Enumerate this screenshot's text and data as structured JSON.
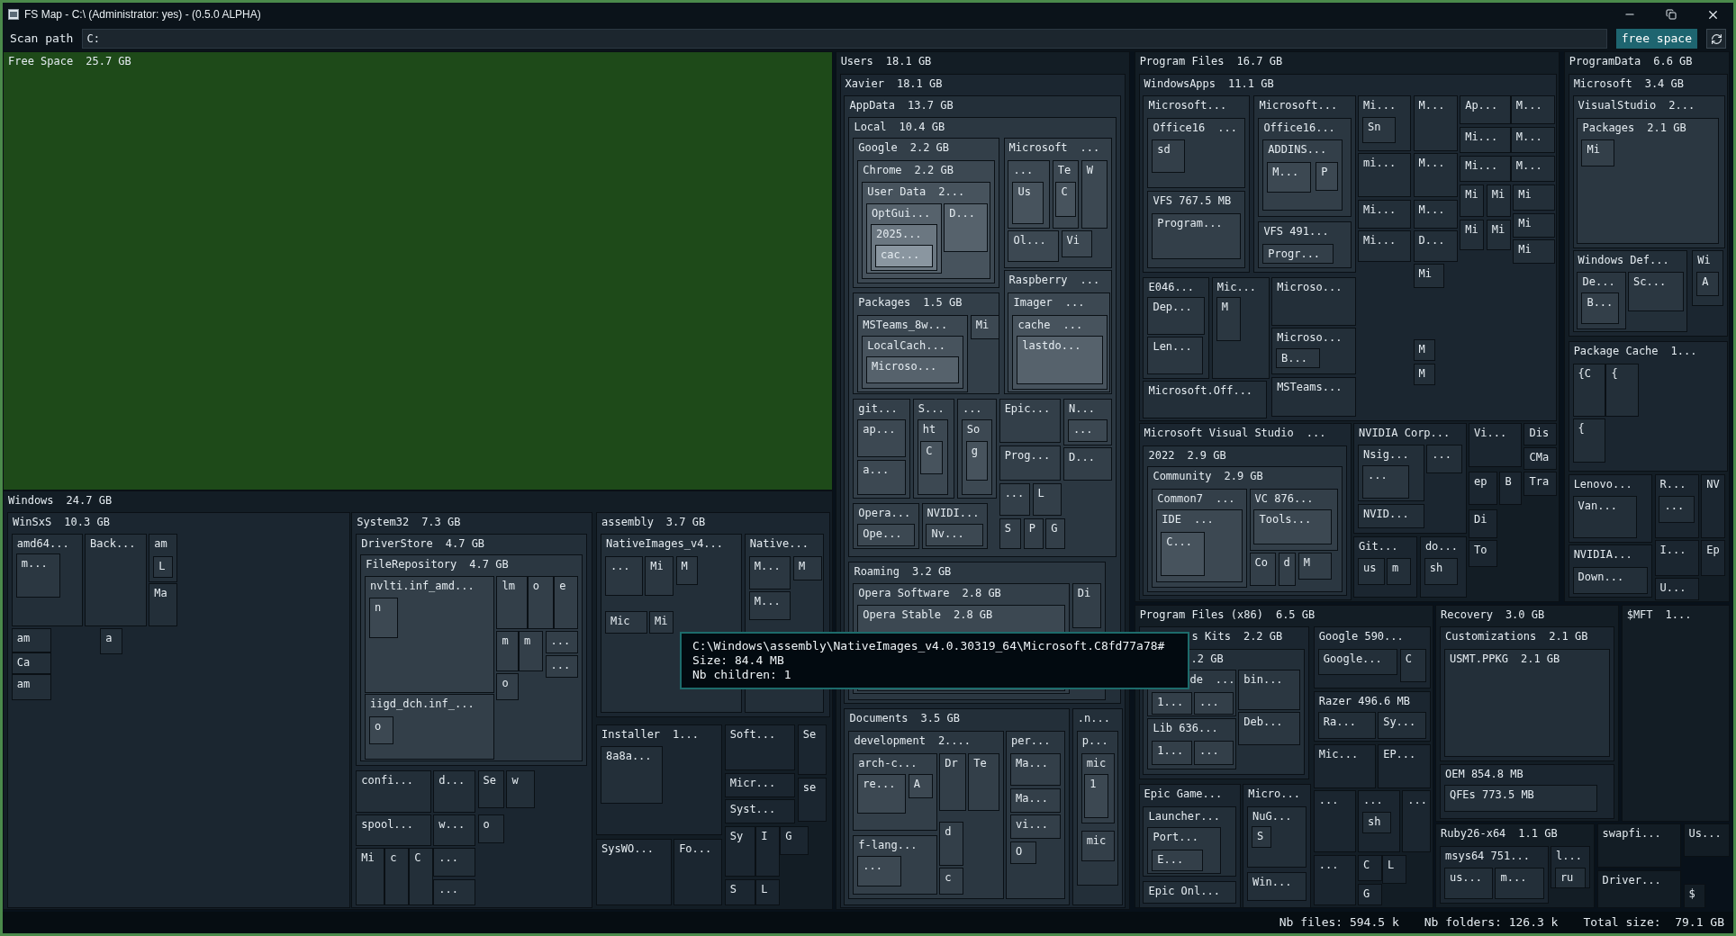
{
  "window": {
    "title": "FS Map - C:\\ (Administrator: yes) - (0.5.0 ALPHA)"
  },
  "toolbar": {
    "scan_label": "Scan path",
    "scan_path": "C:",
    "free_space_button": "free space"
  },
  "treemap": [
    {
      "kind": "free",
      "label": "Free Space",
      "size": "25.7 GB"
    },
    {
      "kind": "folder",
      "label": "Windows",
      "size": "24.7 GB",
      "children": [
        {
          "label": "WinSxS",
          "size": "10.3 GB",
          "children": [
            {
              "label": "amd64...",
              "children": [
                {
                  "label": "m..."
                }
              ]
            },
            {
              "label": "Back..."
            },
            {
              "label": "am",
              "children": [
                {
                  "label": "L"
                }
              ]
            },
            {
              "label": "Ma"
            },
            {
              "label": "am"
            },
            {
              "label": "Ca"
            },
            {
              "label": "am"
            },
            {
              "label": "a"
            }
          ]
        },
        {
          "label": "System32",
          "size": "7.3 GB",
          "children": [
            {
              "label": "DriverStore",
              "size": "4.7 GB",
              "children": [
                {
                  "label": "FileRepository",
                  "size": "4.7 GB",
                  "children": [
                    {
                      "label": "nvlti.inf_amd...",
                      "children": [
                        {
                          "label": "n"
                        }
                      ]
                    },
                    {
                      "label": "iigd_dch.inf_...",
                      "children": [
                        {
                          "label": "o"
                        }
                      ]
                    },
                    {
                      "label": "lm"
                    },
                    {
                      "label": "o"
                    },
                    {
                      "label": "e"
                    },
                    {
                      "label": "m"
                    },
                    {
                      "label": "m"
                    },
                    {
                      "label": "..."
                    },
                    {
                      "label": "..."
                    },
                    {
                      "label": "o"
                    }
                  ]
                }
              ]
            },
            {
              "label": "confi..."
            },
            {
              "label": "d..."
            },
            {
              "label": "Se"
            },
            {
              "label": "w"
            },
            {
              "label": "spool..."
            },
            {
              "label": "w..."
            },
            {
              "label": "o"
            },
            {
              "label": "Mi"
            },
            {
              "label": "c"
            },
            {
              "label": "C"
            },
            {
              "label": "..."
            },
            {
              "label": "..."
            }
          ]
        },
        {
          "label": "assembly",
          "size": "3.7 GB",
          "children": [
            {
              "label": "NativeImages_v4...",
              "children": [
                {
                  "label": "..."
                },
                {
                  "label": "Mi"
                },
                {
                  "label": "M"
                },
                {
                  "label": "Mic"
                },
                {
                  "label": "Mi"
                }
              ]
            },
            {
              "label": "Native...",
              "children": [
                {
                  "label": "M..."
                },
                {
                  "label": "M"
                },
                {
                  "label": "M..."
                }
              ]
            }
          ]
        },
        {
          "label": "Installer",
          "size": "1...",
          "children": [
            {
              "label": "8a8a..."
            }
          ]
        },
        {
          "label": "Soft..."
        },
        {
          "label": "Se"
        },
        {
          "label": "Micr..."
        },
        {
          "label": "se"
        },
        {
          "label": "Syst..."
        },
        {
          "label": "SysWO..."
        },
        {
          "label": "Fo..."
        },
        {
          "label": "Sy"
        },
        {
          "label": "I"
        },
        {
          "label": "G"
        },
        {
          "label": "S"
        },
        {
          "label": "L"
        }
      ]
    },
    {
      "kind": "folder",
      "label": "Users",
      "size": "18.1 GB",
      "children": [
        {
          "label": "Xavier",
          "size": "18.1 GB",
          "children": [
            {
              "label": "AppData",
              "size": "13.7 GB",
              "children": [
                {
                  "label": "Local",
                  "size": "10.4 GB",
                  "children": [
                    {
                      "label": "Google",
                      "size": "2.2 GB",
                      "children": [
                        {
                          "label": "Chrome",
                          "size": "2.2 GB",
                          "children": [
                            {
                              "label": "User Data",
                              "size": "2...",
                              "children": [
                                {
                                  "label": "OptGui...",
                                  "children": [
                                    {
                                      "label": "2025...",
                                      "children": [
                                        {
                                          "label": "cac..."
                                        }
                                      ]
                                    }
                                  ]
                                },
                                {
                                  "label": "D..."
                                }
                              ]
                            }
                          ]
                        }
                      ]
                    },
                    {
                      "label": "Microsoft",
                      "size": "...",
                      "children": [
                        {
                          "label": "...",
                          "children": [
                            {
                              "label": "Us"
                            }
                          ]
                        },
                        {
                          "label": "Te",
                          "children": [
                            {
                              "label": "C"
                            }
                          ]
                        },
                        {
                          "label": "W"
                        },
                        {
                          "label": "Ol..."
                        },
                        {
                          "label": "Vi"
                        }
                      ]
                    },
                    {
                      "label": "Packages",
                      "size": "1.5 GB",
                      "children": [
                        {
                          "label": "MSTeams_8w...",
                          "children": [
                            {
                              "label": "LocalCach...",
                              "children": [
                                {
                                  "label": "Microso..."
                                }
                              ]
                            }
                          ]
                        },
                        {
                          "label": "Mi"
                        }
                      ]
                    },
                    {
                      "label": "Raspberry",
                      "size": "...",
                      "children": [
                        {
                          "label": "Imager",
                          "size": "...",
                          "children": [
                            {
                              "label": "cache",
                              "size": "...",
                              "children": [
                                {
                                  "label": "lastdo..."
                                }
                              ]
                            }
                          ]
                        }
                      ]
                    },
                    {
                      "label": "git...",
                      "children": [
                        {
                          "label": "ap..."
                        },
                        {
                          "label": "a..."
                        }
                      ]
                    },
                    {
                      "label": "S...",
                      "children": [
                        {
                          "label": "ht",
                          "children": [
                            {
                              "label": "C"
                            }
                          ]
                        }
                      ]
                    },
                    {
                      "label": "...",
                      "children": [
                        {
                          "label": "So",
                          "children": [
                            {
                              "label": "g"
                            }
                          ]
                        }
                      ]
                    },
                    {
                      "label": "Epic..."
                    },
                    {
                      "label": "N...",
                      "children": [
                        {
                          "label": "..."
                        }
                      ]
                    },
                    {
                      "label": "Prog..."
                    },
                    {
                      "label": "D..."
                    },
                    {
                      "label": "Opera...",
                      "children": [
                        {
                          "label": "Ope..."
                        }
                      ]
                    },
                    {
                      "label": "NVIDI...",
                      "children": [
                        {
                          "label": "Nv..."
                        }
                      ]
                    },
                    {
                      "label": "..."
                    },
                    {
                      "label": "L"
                    },
                    {
                      "label": "S"
                    },
                    {
                      "label": "P"
                    },
                    {
                      "label": "G"
                    }
                  ]
                },
                {
                  "label": "Roaming",
                  "size": "3.2 GB",
                  "children": [
                    {
                      "label": "Opera Software",
                      "size": "2.8 GB",
                      "children": [
                        {
                          "label": "Opera Stable",
                          "size": "2.8 GB"
                        }
                      ]
                    },
                    {
                      "label": "Di"
                    }
                  ]
                }
              ]
            },
            {
              "label": "Documents",
              "size": "3.5 GB",
              "children": [
                {
                  "label": "development",
                  "size": "2....",
                  "children": [
                    {
                      "label": "arch-c...",
                      "children": [
                        {
                          "label": "re..."
                        },
                        {
                          "label": "A"
                        }
                      ]
                    },
                    {
                      "label": "Dr"
                    },
                    {
                      "label": "Te"
                    },
                    {
                      "label": "f-lang...",
                      "children": [
                        {
                          "label": "..."
                        }
                      ]
                    },
                    {
                      "label": "d"
                    },
                    {
                      "label": "c"
                    }
                  ]
                },
                {
                  "label": "per...",
                  "children": [
                    {
                      "label": "Ma..."
                    },
                    {
                      "label": "Ma..."
                    },
                    {
                      "label": "vi..."
                    },
                    {
                      "label": "O"
                    }
                  ]
                }
              ]
            },
            {
              "label": ".n...",
              "children": [
                {
                  "label": "p...",
                  "children": [
                    {
                      "label": "mic",
                      "children": [
                        {
                          "label": "1"
                        }
                      ]
                    },
                    {
                      "label": "mic"
                    }
                  ]
                }
              ]
            }
          ]
        }
      ]
    },
    {
      "kind": "folder",
      "label": "Program Files",
      "size": "16.7 GB",
      "children": [
        {
          "label": "WindowsApps",
          "size": "11.1 GB",
          "children": [
            {
              "label": "Microsoft...",
              "children": [
                {
                  "label": "Office16",
                  "size": "...",
                  "children": [
                    {
                      "label": "sd"
                    }
                  ]
                },
                {
                  "label": "VFS 767.5 MB",
                  "children": [
                    {
                      "label": "Program..."
                    }
                  ]
                }
              ]
            },
            {
              "label": "Microsoft...",
              "children": [
                {
                  "label": "Office16...",
                  "children": [
                    {
                      "label": "ADDINS...",
                      "children": [
                        {
                          "label": "M..."
                        },
                        {
                          "label": "P"
                        }
                      ]
                    }
                  ]
                },
                {
                  "label": "VFS 491...",
                  "children": [
                    {
                      "label": "Progr..."
                    }
                  ]
                }
              ]
            },
            {
              "label": "Mi...",
              "children": [
                {
                  "label": "Sn"
                }
              ]
            },
            {
              "label": "M..."
            },
            {
              "label": "mi..."
            },
            {
              "label": "M..."
            },
            {
              "label": "Mi..."
            },
            {
              "label": "M..."
            },
            {
              "label": "Mi..."
            },
            {
              "label": "D..."
            },
            {
              "label": "Mi"
            },
            {
              "label": "Ap..."
            },
            {
              "label": "M..."
            },
            {
              "label": "Mi..."
            },
            {
              "label": "M..."
            },
            {
              "label": "Mi..."
            },
            {
              "label": "M..."
            },
            {
              "label": "Mi"
            },
            {
              "label": "Mi"
            },
            {
              "label": "Mi"
            },
            {
              "label": "Mi"
            },
            {
              "label": "Mi"
            },
            {
              "label": "Mi"
            },
            {
              "label": "Mi"
            },
            {
              "label": "M"
            },
            {
              "label": "M"
            },
            {
              "label": "E046...",
              "children": [
                {
                  "label": "Dep..."
                },
                {
                  "label": "Len..."
                }
              ]
            },
            {
              "label": "Mic...",
              "children": [
                {
                  "label": "M"
                }
              ]
            },
            {
              "label": "Microso..."
            },
            {
              "label": "Microso...",
              "children": [
                {
                  "label": "B..."
                }
              ]
            },
            {
              "label": "MSTeams..."
            },
            {
              "label": "Microsoft.Off..."
            }
          ]
        },
        {
          "label": "Microsoft Visual Studio",
          "size": "...",
          "children": [
            {
              "label": "2022",
              "size": "2.9 GB",
              "children": [
                {
                  "label": "Community",
                  "size": "2.9 GB",
                  "children": [
                    {
                      "label": "Common7",
                      "size": "...",
                      "children": [
                        {
                          "label": "IDE",
                          "size": "...",
                          "children": [
                            {
                              "label": "C..."
                            }
                          ]
                        }
                      ]
                    },
                    {
                      "label": "VC 876...",
                      "children": [
                        {
                          "label": "Tools..."
                        }
                      ]
                    },
                    {
                      "label": "Co"
                    },
                    {
                      "label": "d"
                    },
                    {
                      "label": "M"
                    }
                  ]
                }
              ]
            }
          ]
        },
        {
          "label": "NVIDIA Corp...",
          "children": [
            {
              "label": "Nsig...",
              "children": [
                {
                  "label": "..."
                }
              ]
            },
            {
              "label": "..."
            },
            {
              "label": "NVID..."
            }
          ]
        },
        {
          "label": "Vi..."
        },
        {
          "label": "Dis"
        },
        {
          "label": "CMa"
        },
        {
          "label": "ep"
        },
        {
          "label": "B"
        },
        {
          "label": "Tra"
        },
        {
          "label": "Di"
        },
        {
          "label": "Git...",
          "children": [
            {
              "label": "us"
            },
            {
              "label": "m"
            }
          ]
        },
        {
          "label": "do...",
          "children": [
            {
              "label": "sh"
            }
          ]
        },
        {
          "label": "To"
        }
      ]
    },
    {
      "kind": "folder",
      "label": "ProgramData",
      "size": "6.6 GB",
      "children": [
        {
          "label": "Microsoft",
          "size": "3.4 GB",
          "children": [
            {
              "label": "VisualStudio",
              "size": "2...",
              "children": [
                {
                  "label": "Packages",
                  "size": "2.1 GB",
                  "children": [
                    {
                      "label": "Mi"
                    }
                  ]
                }
              ]
            },
            {
              "label": "Windows Def...",
              "children": [
                {
                  "label": "De...",
                  "children": [
                    {
                      "label": "B..."
                    }
                  ]
                },
                {
                  "label": "Sc..."
                }
              ]
            },
            {
              "label": "Wi",
              "children": [
                {
                  "label": "A"
                }
              ]
            }
          ]
        },
        {
          "label": "Package Cache",
          "size": "1...",
          "children": [
            {
              "label": "{C"
            },
            {
              "label": "{"
            },
            {
              "label": "{"
            }
          ]
        },
        {
          "label": "Lenovo...",
          "children": [
            {
              "label": "Van..."
            }
          ]
        },
        {
          "label": "R...",
          "children": [
            {
              "label": "..."
            }
          ]
        },
        {
          "label": "NV"
        },
        {
          "label": "NVIDIA...",
          "children": [
            {
              "label": "Down..."
            }
          ]
        },
        {
          "label": "I..."
        },
        {
          "label": "Ep"
        },
        {
          "label": "U..."
        }
      ]
    },
    {
      "kind": "folder",
      "label": "Program Files (x86)",
      "size": "6.5 GB",
      "children": [
        {
          "label": "s Kits",
          "size": "2.2 GB",
          "children": [
            {
              "label": ".2 GB",
              "children": [
                {
                  "label": "de",
                  "size": "...",
                  "children": [
                    {
                      "label": "1..."
                    },
                    {
                      "label": "..."
                    }
                  ]
                },
                {
                  "label": "bin..."
                },
                {
                  "label": "Lib 636...",
                  "children": [
                    {
                      "label": "1..."
                    },
                    {
                      "label": "..."
                    }
                  ]
                },
                {
                  "label": "Deb..."
                }
              ]
            }
          ]
        },
        {
          "label": "Google 590...",
          "children": [
            {
              "label": "Google..."
            },
            {
              "label": "C"
            }
          ]
        },
        {
          "label": "Razer 496.6 MB",
          "children": [
            {
              "label": "Ra..."
            },
            {
              "label": "Sy..."
            }
          ]
        },
        {
          "label": "Mic..."
        },
        {
          "label": "EP..."
        },
        {
          "label": "Epic Game...",
          "children": [
            {
              "label": "Launcher...",
              "children": [
                {
                  "label": "Port...",
                  "children": [
                    {
                      "label": "E..."
                    }
                  ]
                }
              ]
            },
            {
              "label": "Epic Onl..."
            }
          ]
        },
        {
          "label": "Micro...",
          "children": [
            {
              "label": "NuG...",
              "children": [
                {
                  "label": "S"
                }
              ]
            },
            {
              "label": "Win..."
            }
          ]
        },
        {
          "label": "..."
        },
        {
          "label": "...",
          "children": [
            {
              "label": "sh"
            }
          ]
        },
        {
          "label": "..."
        },
        {
          "label": "..."
        },
        {
          "label": "C"
        },
        {
          "label": "L"
        },
        {
          "label": "G"
        }
      ]
    },
    {
      "kind": "folder",
      "label": "Recovery",
      "size": "3.0 GB",
      "children": [
        {
          "label": "Customizations",
          "size": "2.1 GB",
          "children": [
            {
              "label": "USMT.PPKG",
              "size": "2.1 GB"
            }
          ]
        },
        {
          "label": "OEM 854.8 MB",
          "children": [
            {
              "label": "QFEs 773.5 MB"
            }
          ]
        }
      ]
    },
    {
      "kind": "folder",
      "label": "$MFT",
      "size": "1..."
    },
    {
      "kind": "folder",
      "label": "Ruby26-x64",
      "size": "1.1 GB",
      "children": [
        {
          "label": "msys64 751...",
          "children": [
            {
              "label": "us..."
            },
            {
              "label": "m..."
            }
          ]
        },
        {
          "label": "l...",
          "children": [
            {
              "label": "ru"
            }
          ]
        }
      ]
    },
    {
      "kind": "folder",
      "label": "swapfi..."
    },
    {
      "kind": "folder",
      "label": "Us..."
    },
    {
      "kind": "folder",
      "label": "Driver..."
    },
    {
      "kind": "folder",
      "label": "$"
    }
  ],
  "tooltip": {
    "path": "C:\\Windows\\assembly\\NativeImages_v4.0.30319_64\\Microsoft.C8fd77a78#",
    "size": "Size: 84.4 MB",
    "children": "Nb children: 1"
  },
  "status_bar": [
    "Nb files: 594.5 k",
    "Nb folders: 126.3 k",
    "Total size:  79.1 GB"
  ]
}
